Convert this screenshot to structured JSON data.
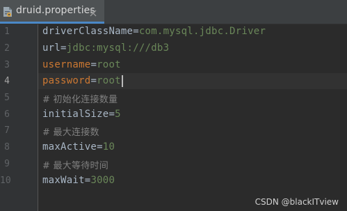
{
  "tab": {
    "filename": "druid.properties",
    "icon": "properties-file-icon",
    "close_icon": "close-icon"
  },
  "gutter": {
    "line_numbers": [
      "1",
      "2",
      "3",
      "4",
      "5",
      "6",
      "7",
      "8",
      "9",
      "10"
    ],
    "current_line": "4"
  },
  "code": {
    "l1_key": "driverClassName",
    "l1_eq": "=",
    "l1_val": "com.mysql.jdbc.Driver",
    "l2_key": "url",
    "l2_eq": "=",
    "l2_val": "jdbc:mysql:///db3",
    "l3_key": "username",
    "l3_eq": "=",
    "l3_val": "root",
    "l4_key": "password",
    "l4_eq": "=",
    "l4_val": "root",
    "l5_comment": "# 初始化连接数量",
    "l6_key": "initialSize",
    "l6_eq": "=",
    "l6_val": "5",
    "l7_comment": "# 最大连接数",
    "l8_key": "maxActive",
    "l8_eq": "=",
    "l8_val": "10",
    "l9_comment": "# 最大等待时间",
    "l10_key": "maxWait",
    "l10_eq": "=",
    "l10_val": "3000"
  },
  "watermark": "CSDN @blackITview",
  "colors": {
    "background": "#2b2b2b",
    "gutter": "#313335",
    "tab_active": "#4e5254",
    "tab_underline": "#4a88c7",
    "key": "#a9b7c6",
    "keyword_orange": "#cc7832",
    "value_green": "#6a8759",
    "comment": "#808080",
    "line_number": "#606366"
  }
}
